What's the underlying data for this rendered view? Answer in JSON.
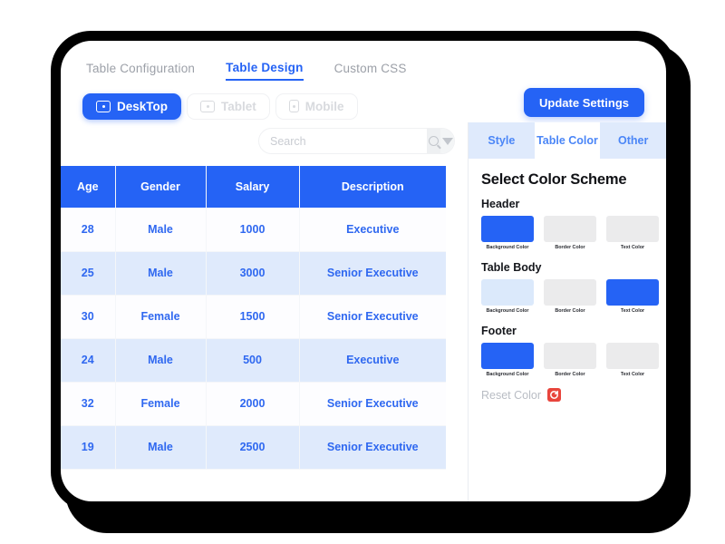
{
  "main_tabs": [
    {
      "label": "Table Configuration",
      "active": false
    },
    {
      "label": "Table Design",
      "active": true
    },
    {
      "label": "Custom CSS",
      "active": false
    }
  ],
  "device_buttons": [
    {
      "label": "DeskTop",
      "icon": "desktop-screen-icon",
      "active": true
    },
    {
      "label": "Tablet",
      "icon": "tablet-screen-icon",
      "active": false
    },
    {
      "label": "Mobile",
      "icon": "mobile-screen-icon",
      "active": false
    }
  ],
  "toolbar": {
    "update_settings_label": "Update Settings"
  },
  "search": {
    "placeholder": "Search",
    "value": "",
    "icon": "search-icon",
    "dropdown_icon": "caret-down-icon"
  },
  "table": {
    "columns": [
      "Age",
      "Gender",
      "Salary",
      "Description"
    ],
    "rows": [
      [
        "28",
        "Male",
        "1000",
        "Executive"
      ],
      [
        "25",
        "Male",
        "3000",
        "Senior Executive"
      ],
      [
        "30",
        "Female",
        "1500",
        "Senior Executive"
      ],
      [
        "24",
        "Male",
        "500",
        "Executive"
      ],
      [
        "32",
        "Female",
        "2000",
        "Senior Executive"
      ],
      [
        "19",
        "Male",
        "2500",
        "Senior Executive"
      ]
    ],
    "header_bg": "#2563f5",
    "header_text": "#ffffff",
    "body_text": "#2f68f0",
    "stripe_bg": "#dfeafc"
  },
  "panel": {
    "tabs": [
      {
        "label": "Style",
        "active": false
      },
      {
        "label": "Table Color",
        "active": true
      },
      {
        "label": "Other",
        "active": false
      }
    ],
    "title": "Select Color Scheme",
    "groups": [
      {
        "name": "Header",
        "swatches": [
          {
            "label": "Background Color",
            "color": "#2563f5"
          },
          {
            "label": "Border Color",
            "color": "#ebebec"
          },
          {
            "label": "Text Color",
            "color": "#ebebec"
          }
        ]
      },
      {
        "name": "Table Body",
        "swatches": [
          {
            "label": "Background Color",
            "color": "#dbe9fb"
          },
          {
            "label": "Border Color",
            "color": "#ebebec"
          },
          {
            "label": "Text Color",
            "color": "#2563f5"
          }
        ]
      },
      {
        "name": "Footer",
        "swatches": [
          {
            "label": "Background Color",
            "color": "#2563f5"
          },
          {
            "label": "Border Color",
            "color": "#ebebec"
          },
          {
            "label": "Text Color",
            "color": "#ebebec"
          }
        ]
      }
    ],
    "reset_label": "Reset Color",
    "reset_icon": "reset-color-icon"
  }
}
